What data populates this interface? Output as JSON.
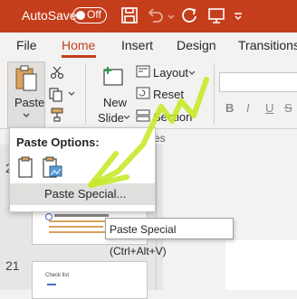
{
  "titlebar": {
    "autosave_label": "AutoSave",
    "toggle_state": "Off",
    "icons": [
      "save-icon",
      "undo-icon",
      "redo-icon",
      "chevron-down-icon"
    ],
    "accent": "#c43e1c"
  },
  "tabs": [
    {
      "label": "File"
    },
    {
      "label": "Home",
      "selected": true
    },
    {
      "label": "Insert"
    },
    {
      "label": "Design"
    },
    {
      "label": "Transitions"
    }
  ],
  "ribbon": {
    "paste_label": "Paste",
    "new_slide_label_1": "New",
    "new_slide_label_2": "Slide",
    "layout_label": "Layout",
    "reset_label": "Reset",
    "section_label": "Section",
    "slides_group_label": "Slides",
    "font_buttons": [
      "B",
      "I",
      "U",
      "S"
    ]
  },
  "dropdown": {
    "header": "Paste Options:",
    "paste_special": "Paste Special..."
  },
  "tooltip": "Paste Special (Ctrl+Alt+V)",
  "slides": {
    "number_top": "2",
    "number_bottom": "21",
    "thumb_bottom_title": "Check list"
  }
}
